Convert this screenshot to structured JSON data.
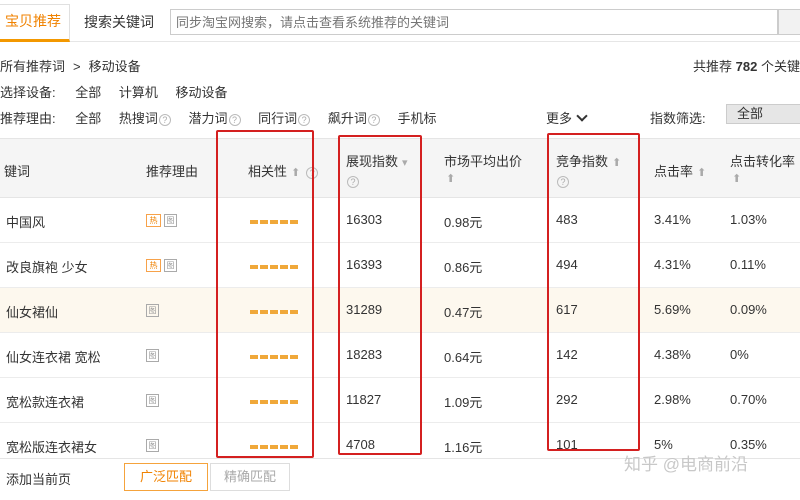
{
  "tabs": {
    "active_label": "宝贝推荐",
    "search_label": "搜索关键词"
  },
  "search": {
    "placeholder": "同步淘宝网搜索，请点击查看系统推荐的关键词"
  },
  "breadcrumb": {
    "root": "所有推荐词",
    "separator": ">",
    "current": "移动设备"
  },
  "total": {
    "prefix": "共推荐",
    "count": "782",
    "suffix": "个关键"
  },
  "device_filter": {
    "label": "选择设备:",
    "options": [
      "全部",
      "计算机",
      "移动设备"
    ]
  },
  "reason_filter": {
    "label": "推荐理由:",
    "options": [
      "全部",
      "热搜词",
      "潜力词",
      "同行词",
      "飙升词",
      "手机标"
    ],
    "more_label": "更多"
  },
  "index_filter": {
    "label": "指数筛选:",
    "selected": "全部"
  },
  "table": {
    "headers": {
      "keyword": "键词",
      "reason": "推荐理由",
      "relevance": "相关性",
      "impressions": "展现指数",
      "avg_bid": "市场平均出价",
      "competition": "竞争指数",
      "ctr": "点击率",
      "cvr": "点击转化率"
    },
    "rows": [
      {
        "keyword": "中国风",
        "hot_tag": "热",
        "impressions": "16303",
        "avg_bid": "0.98元",
        "competition": "483",
        "ctr": "3.41%",
        "cvr": "1.03%",
        "relevance": 1.0
      },
      {
        "keyword": "改良旗袍 少女",
        "hot_tag": "热",
        "impressions": "16393",
        "avg_bid": "0.86元",
        "competition": "494",
        "ctr": "4.31%",
        "cvr": "0.11%",
        "relevance": 1.0
      },
      {
        "keyword": "仙女裙仙",
        "hot_tag": "",
        "impressions": "31289",
        "avg_bid": "0.47元",
        "competition": "617",
        "ctr": "5.69%",
        "cvr": "0.09%",
        "relevance": 1.0
      },
      {
        "keyword": "仙女连衣裙 宽松",
        "hot_tag": "",
        "impressions": "18283",
        "avg_bid": "0.64元",
        "competition": "142",
        "ctr": "4.38%",
        "cvr": "0%",
        "relevance": 1.0
      },
      {
        "keyword": "宽松款连衣裙",
        "hot_tag": "",
        "impressions": "11827",
        "avg_bid": "1.09元",
        "competition": "292",
        "ctr": "2.98%",
        "cvr": "0.70%",
        "relevance": 1.0
      },
      {
        "keyword": "宽松版连衣裙女",
        "hot_tag": "",
        "impressions": "4708",
        "avg_bid": "1.16元",
        "competition": "101",
        "ctr": "5%",
        "cvr": "0.35%",
        "relevance": 1.0
      }
    ],
    "row_tag": "图"
  },
  "footer": {
    "add_page": "添加当前页",
    "broad_match": "广泛匹配",
    "exact_match": "精确匹配"
  },
  "watermark": "知乎 @电商前沿",
  "colors": {
    "accent": "#f08200",
    "highlight_box": "#d42020",
    "highlight_row": "#fdf8ee"
  }
}
